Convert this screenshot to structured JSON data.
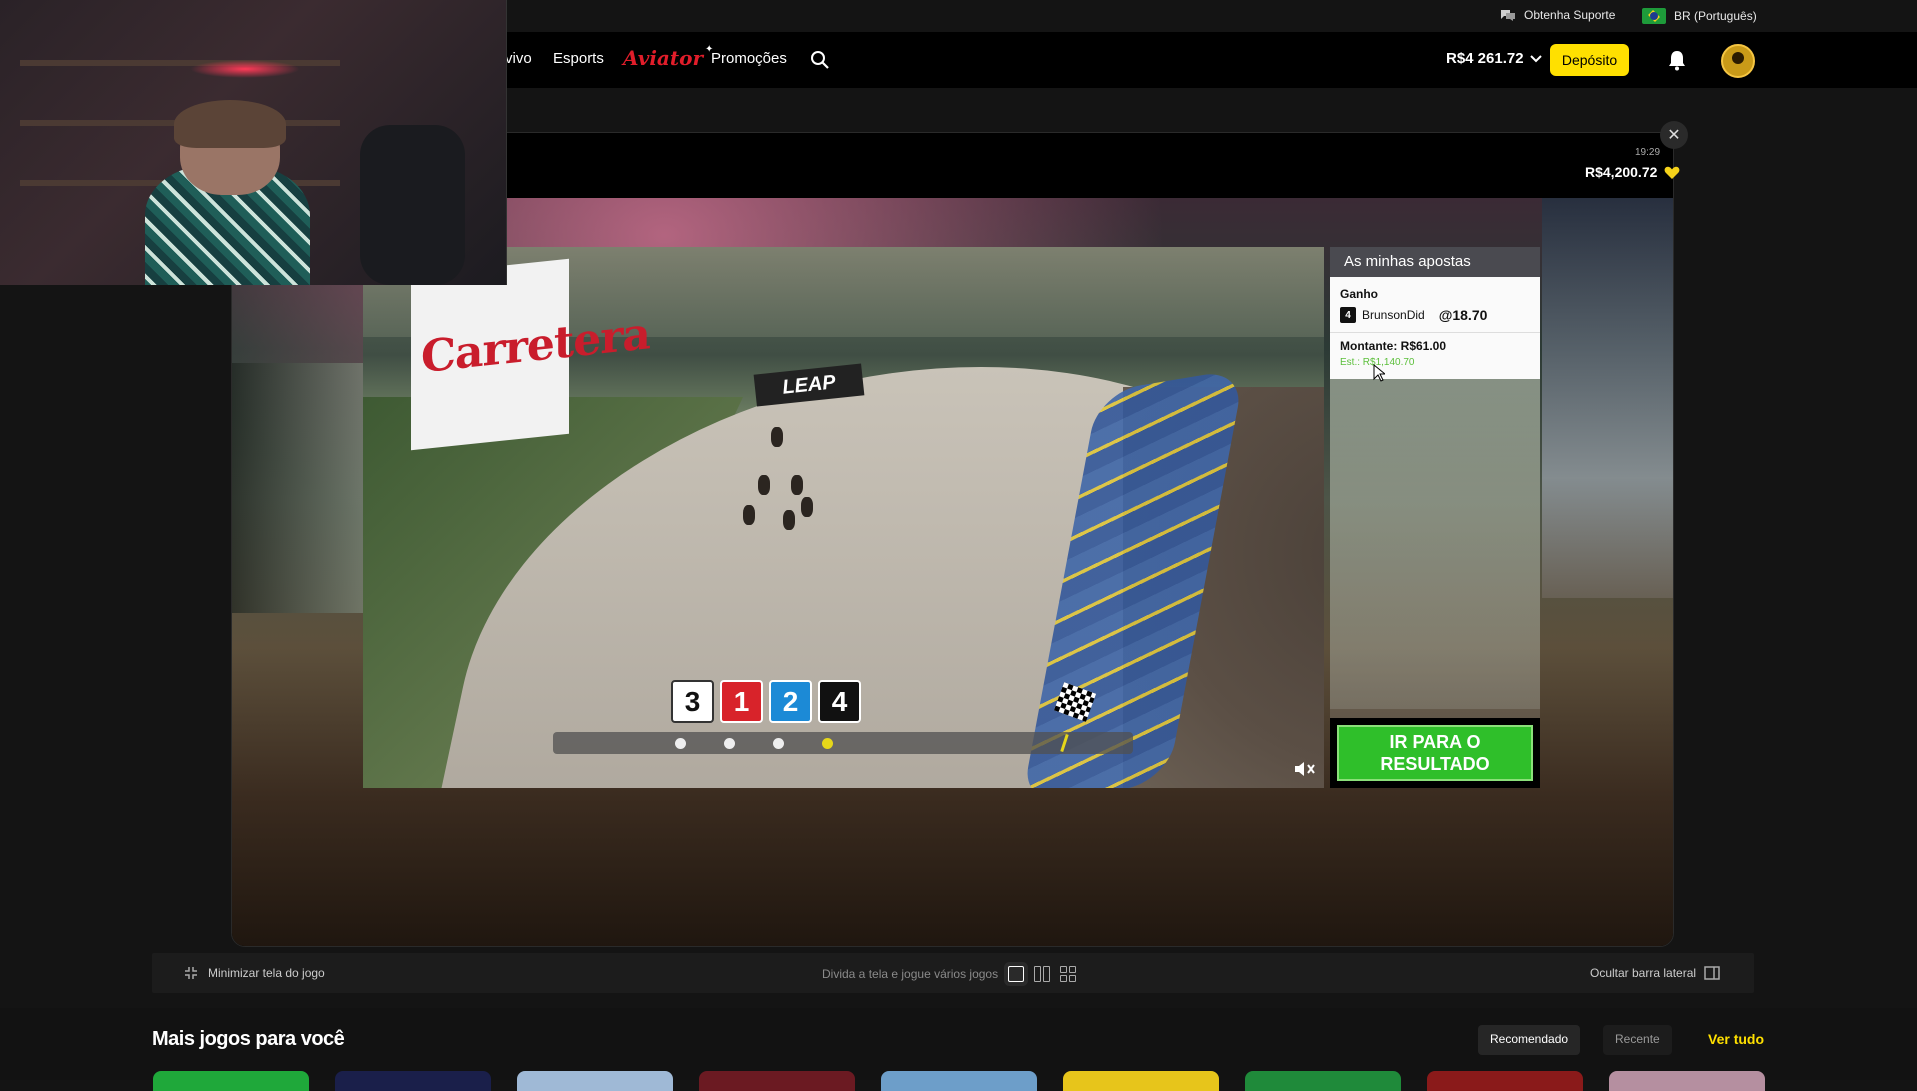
{
  "top_bar": {
    "support_label": "Obtenha Suporte",
    "language_label": "BR (Português)"
  },
  "nav": {
    "items": [
      "vivo",
      "Esports",
      "Aviator",
      "Promoções"
    ],
    "balance": "R$4 261.72",
    "deposit_label": "Depósito"
  },
  "game": {
    "time": "19:29",
    "balance": "R$4,200.72",
    "sign_text": "Carretera",
    "sponsor": "LEAP",
    "positions": [
      "3",
      "1",
      "2",
      "4"
    ],
    "progress_dots": 4,
    "active_dot": 4
  },
  "bets_panel": {
    "title": "As minhas apostas",
    "bet_type": "Ganho",
    "trap_number": "4",
    "runner": "BrunsonDid",
    "odds": "@18.70",
    "stake": "Montante: R$61.00",
    "estimate": "Est.: R$1,140.70",
    "result_button": "IR PARA O RESULTADO"
  },
  "controls": {
    "minimize_label": "Minimizar tela do jogo",
    "split_label": "Divida a tela e jogue vários jogos",
    "hide_sidebar_label": "Ocultar barra lateral"
  },
  "more_games": {
    "title": "Mais jogos para você",
    "tabs": [
      "Recomendado",
      "Recente"
    ],
    "see_all": "Ver tudo",
    "thumb_colors": [
      "#1fa83a",
      "#1a1f4a",
      "#9fb9d6",
      "#6b1a22",
      "#6d9ec9",
      "#e7c51b",
      "#1f8a3a",
      "#8a1a1a",
      "#b58fa0"
    ]
  },
  "colors": {
    "accent_yellow": "#ffe000",
    "result_green": "#2fbf2a",
    "aviator_red": "#e11d2a"
  }
}
